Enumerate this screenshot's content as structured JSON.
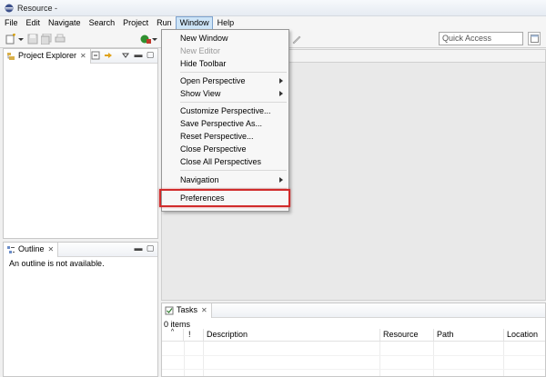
{
  "window": {
    "title": "Resource -"
  },
  "menubar": {
    "items": [
      "File",
      "Edit",
      "Navigate",
      "Search",
      "Project",
      "Run",
      "Window",
      "Help"
    ],
    "active": "Window"
  },
  "toolbar": {
    "quick_access_placeholder": "Quick Access"
  },
  "project_explorer": {
    "tab_label": "Project Explorer"
  },
  "outline": {
    "tab_label": "Outline",
    "message": "An outline is not available."
  },
  "tasks": {
    "tab_label": "Tasks",
    "count_text": "0 items",
    "columns": [
      "!",
      "Description",
      "Resource",
      "Path",
      "Location"
    ]
  },
  "window_menu": {
    "items": [
      {
        "label": "New Window",
        "enabled": true,
        "submenu": false
      },
      {
        "label": "New Editor",
        "enabled": false,
        "submenu": false
      },
      {
        "label": "Hide Toolbar",
        "enabled": true,
        "submenu": false
      },
      {
        "label": "Open Perspective",
        "enabled": true,
        "submenu": true
      },
      {
        "label": "Show View",
        "enabled": true,
        "submenu": true
      },
      {
        "label": "Customize Perspective...",
        "enabled": true,
        "submenu": false
      },
      {
        "label": "Save Perspective As...",
        "enabled": true,
        "submenu": false
      },
      {
        "label": "Reset Perspective...",
        "enabled": true,
        "submenu": false
      },
      {
        "label": "Close Perspective",
        "enabled": true,
        "submenu": false
      },
      {
        "label": "Close All Perspectives",
        "enabled": true,
        "submenu": false
      },
      {
        "label": "Navigation",
        "enabled": true,
        "submenu": true
      },
      {
        "label": "Preferences",
        "enabled": true,
        "submenu": false
      }
    ],
    "highlighted": "Preferences",
    "highlight_color": "#d12b2b"
  }
}
